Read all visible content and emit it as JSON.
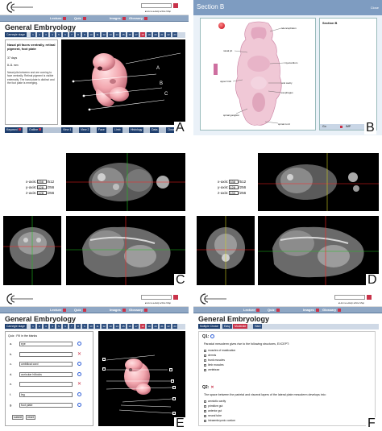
{
  "labels": {
    "a": "A",
    "b": "B",
    "c": "C",
    "d": "D",
    "e": "E",
    "f": "F"
  },
  "app": {
    "title": "General Embryology",
    "logo_text": "CYBER EMBRYOLOGY",
    "nav": [
      "Lecture",
      "Quiz",
      "Images",
      "Glossary"
    ],
    "toplinks": "▸Home  ▸Help  ▸Site Map",
    "section_tag": "Carnegie stage",
    "pages": [
      "1",
      "2",
      "3",
      "4",
      "5",
      "6",
      "7",
      "8",
      "9",
      "10",
      "11",
      "12",
      "13",
      "14",
      "15",
      "16",
      "17",
      "18",
      "19",
      "20",
      "21",
      "22",
      "23"
    ]
  },
  "panel_a": {
    "heading": "Nasal pit faces ventrally, retinal pigment, foot plate",
    "days": "37 days",
    "size": "8-11 mm",
    "body": "Nasal pits between and are coming to face ventrally. Retinal pigment is visible externally. The hand plate is distinct and the foot plate is emerging.",
    "callouts": [
      "A",
      "B",
      "C"
    ],
    "bottom_left": [
      "Keyword",
      "Outline"
    ],
    "bottom_right": [
      "View 1",
      "View 2",
      "Face",
      "Limb",
      "Histology",
      "Data",
      "Close"
    ]
  },
  "panel_b": {
    "title": "Section B",
    "close": "Close",
    "side_title": "Section B",
    "annotations": [
      "telencephalon",
      "nasal pit",
      "myocardium",
      "upper limb",
      "oral cavity",
      "esophagus",
      "spinal ganglion",
      "spinal cord"
    ],
    "footer": [
      "Go",
      "IMP"
    ]
  },
  "panel_c": {
    "axes": [
      {
        "label": "x-axis:",
        "value": "256",
        "max": "/512"
      },
      {
        "label": "y-axis:",
        "value": "128",
        "max": "/256"
      },
      {
        "label": "z-axis:",
        "value": "128",
        "max": "/256"
      }
    ]
  },
  "panel_d": {
    "axes": [
      {
        "label": "x-axis:",
        "value": "338",
        "max": "/512"
      },
      {
        "label": "y-axis:",
        "value": "128",
        "max": "/256"
      },
      {
        "label": "z-axis:",
        "value": "133",
        "max": "/256"
      }
    ]
  },
  "panel_e": {
    "quiz_title": "Quiz : Fill in the blanks",
    "rows": [
      {
        "letter": "a.",
        "answer": "eye",
        "mark": "o"
      },
      {
        "letter": "b.",
        "answer": "",
        "mark": "x"
      },
      {
        "letter": "c.",
        "answer": "umbilical cord",
        "mark": "o"
      },
      {
        "letter": "d.",
        "answer": "auricular hillocks",
        "mark": "o"
      },
      {
        "letter": "e.",
        "answer": "",
        "mark": "x"
      },
      {
        "letter": "f.",
        "answer": "leg",
        "mark": "o"
      },
      {
        "letter": "g.",
        "answer": "foot plate",
        "mark": "o"
      }
    ],
    "buttons": [
      "submit",
      "reset"
    ],
    "callouts": [
      "a",
      "b",
      "c",
      "d",
      "e",
      "f",
      "g"
    ]
  },
  "panel_f": {
    "tabs": [
      "Multiple Choice",
      "Easy",
      "Moderate",
      "Hard"
    ],
    "q1_label": "Q1:",
    "q1_text": "Paraxial mesoderm gives rise to the following structures, EXCEPT:",
    "q1_options": [
      "muscles of mastication",
      "dermis",
      "trunk muscles",
      "limb muscles",
      "vertebrae"
    ],
    "q2_label": "Q2:",
    "q2_text": "The space between the parietal and visceral layers of the lateral plate mesoderm develops into:",
    "q2_options": [
      "amniotic cavity",
      "primitive gut",
      "anterior gut",
      "neural tube",
      "intraembryonic coelom"
    ]
  }
}
